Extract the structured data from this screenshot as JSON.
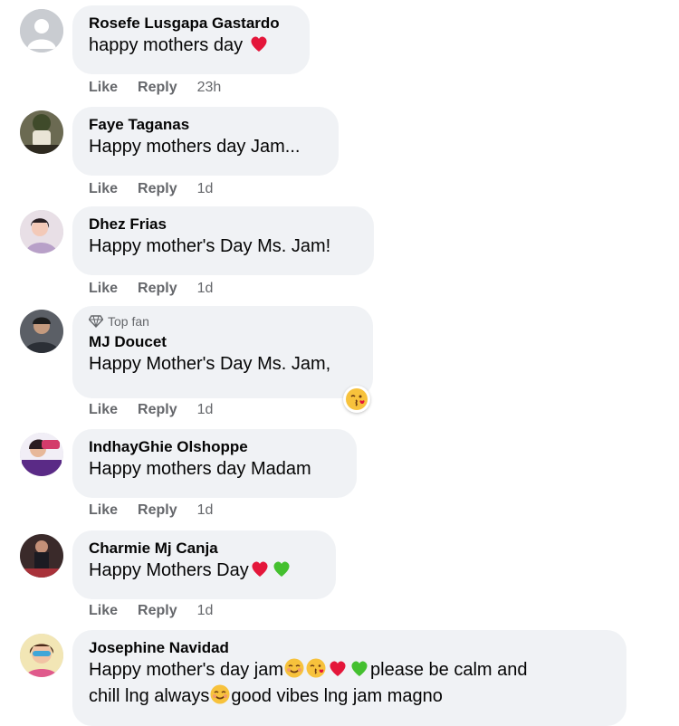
{
  "comments": [
    {
      "name": "Rosefe Lusgapa Gastardo",
      "text": "happy mothers day ",
      "emoji_end": [
        "heart"
      ],
      "like": "Like",
      "reply": "Reply",
      "time": "23h"
    },
    {
      "name": "Faye Taganas",
      "text": "Happy mothers day Jam...",
      "like": "Like",
      "reply": "Reply",
      "time": "1d"
    },
    {
      "name": "Dhez Frias",
      "text": "Happy mother's Day Ms. Jam!",
      "like": "Like",
      "reply": "Reply",
      "time": "1d"
    },
    {
      "badge": "Top fan",
      "name": "MJ Doucet",
      "text": "Happy Mother's Day Ms. Jam,",
      "like": "Like",
      "reply": "Reply",
      "time": "1d",
      "reaction": "kiss-face"
    },
    {
      "name": "IndhayGhie Olshoppe",
      "text": "Happy mothers day Madam",
      "like": "Like",
      "reply": "Reply",
      "time": "1d"
    },
    {
      "name": "Charmie Mj Canja",
      "text": "Happy Mothers Day",
      "emoji_end": [
        "heart",
        "green-heart"
      ],
      "like": "Like",
      "reply": "Reply",
      "time": "1d"
    },
    {
      "name": "Josephine Navidad",
      "line1": "Happy mother's day jam",
      "line1_after": "please be calm and",
      "line2": "chill lng always",
      "line2_after": "good vibes lng jam magno"
    }
  ],
  "icons": {
    "badge": "diamond-icon",
    "default_avatar": "default-avatar-icon"
  },
  "colors": {
    "bubble": "#f0f2f5",
    "meta": "#65676b",
    "heart": "#e4163a",
    "green_heart": "#44c02f"
  }
}
